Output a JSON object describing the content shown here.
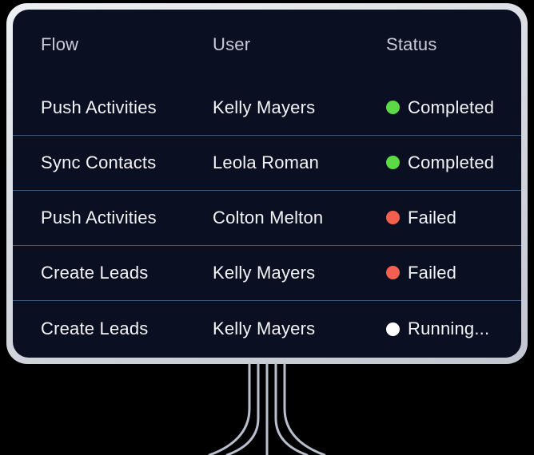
{
  "device": {
    "type": "monitor-card",
    "bezel_color": "#c2c6d0",
    "screen_background": "#0a0f21",
    "cable_color": "#b9bfcc",
    "cable_count": 5
  },
  "table": {
    "divider_color": "#3b5a82",
    "header_text_color": "#c7ccd8",
    "body_text_color": "#f2f4f8",
    "columns": [
      {
        "key": "flow",
        "label": "Flow"
      },
      {
        "key": "user",
        "label": "User"
      },
      {
        "key": "status",
        "label": "Status"
      }
    ],
    "rows": [
      {
        "flow": "Push Activities",
        "user": "Kelly Mayers",
        "status": {
          "label": "Completed",
          "color": "#5cd946",
          "state": "completed"
        }
      },
      {
        "flow": "Sync Contacts",
        "user": "Leola Roman",
        "status": {
          "label": "Completed",
          "color": "#5cd946",
          "state": "completed"
        }
      },
      {
        "flow": "Push Activities",
        "user": "Colton Melton",
        "status": {
          "label": "Failed",
          "color": "#f4604f",
          "state": "failed"
        }
      },
      {
        "flow": "Create Leads",
        "user": "Kelly Mayers",
        "status": {
          "label": "Failed",
          "color": "#f4604f",
          "state": "failed"
        }
      },
      {
        "flow": "Create Leads",
        "user": "Kelly Mayers",
        "status": {
          "label": "Running...",
          "color": "#ffffff",
          "state": "running"
        }
      }
    ]
  }
}
